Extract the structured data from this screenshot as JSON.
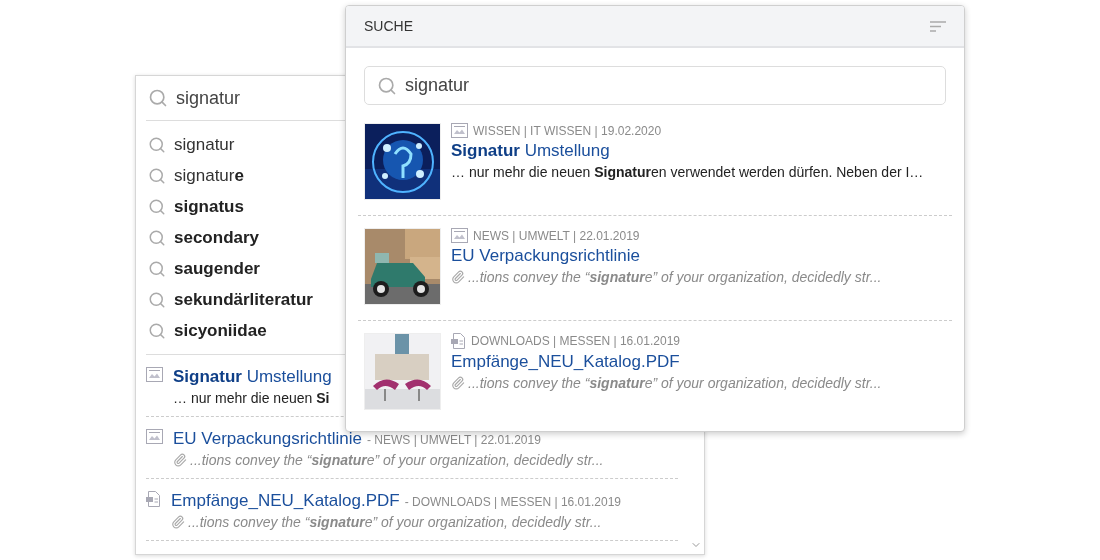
{
  "back_panel": {
    "search": {
      "value": "signatur"
    },
    "suggestions": [
      "signatur",
      "signatur**e**",
      "**signatus**",
      "**secondary**",
      "**saugender**",
      "**sekundärliteratur**",
      "**sicyoniidae**"
    ],
    "results": [
      {
        "kind": "article",
        "title": "**Signatur** Umstellung",
        "snippet": "… nur mehr die neuen **Si**",
        "attachment": false
      },
      {
        "kind": "article",
        "title": "EU Verpackungsrichtlinie",
        "meta": "- NEWS | UMWELT | 22.01.2019",
        "snippet": "...tions convey the “**signatur**e” of your organization, decidedly str...",
        "attachment": true
      },
      {
        "kind": "document",
        "title": "Empfänge_NEU_Katalog.PDF",
        "meta": "- DOWNLOADS | MESSEN | 16.01.2019",
        "snippet": "...tions convey the “**signatur**e” of your organization, decidedly str...",
        "attachment": true
      }
    ]
  },
  "front_panel": {
    "title": "SUCHE",
    "search": {
      "value": "signatur"
    },
    "results": [
      {
        "kind": "article",
        "meta": "WISSEN | IT WISSEN | 19.02.2020",
        "title": "**Signatur** Umstellung",
        "snippet": "… nur mehr die neuen **Signatur**en verwendet werden dürfen. Neben der I…",
        "attachment": false
      },
      {
        "kind": "article",
        "meta": "NEWS | UMWELT | 22.01.2019",
        "title": "EU Verpackungsrichtlinie",
        "snippet": "...tions convey the “**signatur**e” of your organization, decidedly str...",
        "attachment": true
      },
      {
        "kind": "document",
        "meta": "DOWNLOADS | MESSEN | 16.01.2019",
        "title": "Empfänge_NEU_Katalog.PDF",
        "snippet": "...tions convey the “**signatur**e” of your organization, decidedly str...",
        "attachment": true
      }
    ]
  }
}
